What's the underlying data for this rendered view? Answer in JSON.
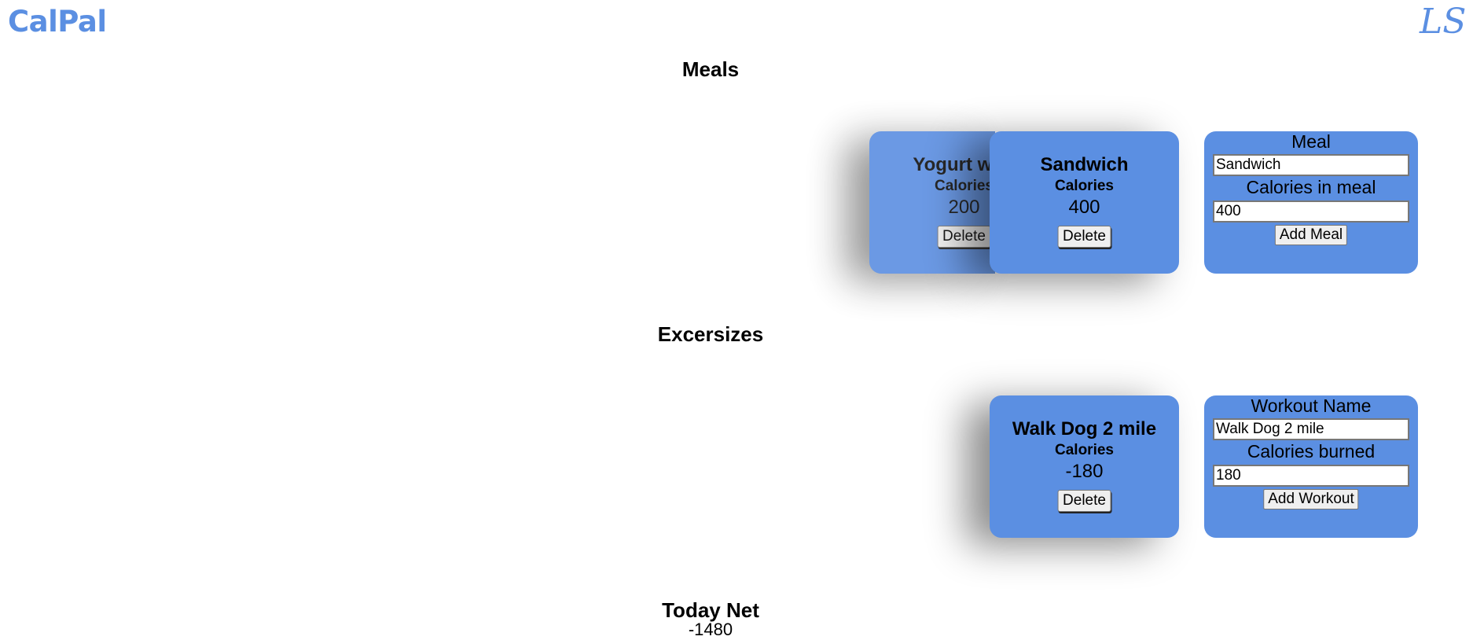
{
  "app": {
    "logo": "CalPal",
    "user_initials": "LS"
  },
  "meals": {
    "heading": "Meals",
    "items": [
      {
        "name": "Yogurt with",
        "calories_label": "Calories",
        "calories": "200",
        "delete_label": "Delete"
      },
      {
        "name": "Sandwich",
        "calories_label": "Calories",
        "calories": "400",
        "delete_label": "Delete"
      }
    ],
    "form": {
      "meal_label": "Meal",
      "meal_value": "Sandwich",
      "calories_label": "Calories in meal",
      "calories_value": "400",
      "submit_label": "Add Meal"
    }
  },
  "exercises": {
    "heading": "Excersizes",
    "items": [
      {
        "name": "Walk Dog 2 mile",
        "calories_label": "Calories",
        "calories": "-180",
        "delete_label": "Delete"
      }
    ],
    "form": {
      "name_label": "Workout Name",
      "name_value": "Walk Dog 2 mile",
      "calories_label": "Calories burned",
      "calories_value": "180",
      "submit_label": "Add Workout"
    }
  },
  "summary": {
    "heading": "Today Net",
    "value": "-1480"
  },
  "colors": {
    "brand": "#5b8fe2",
    "card": "#5b8fe2",
    "background": "#ffffff"
  }
}
